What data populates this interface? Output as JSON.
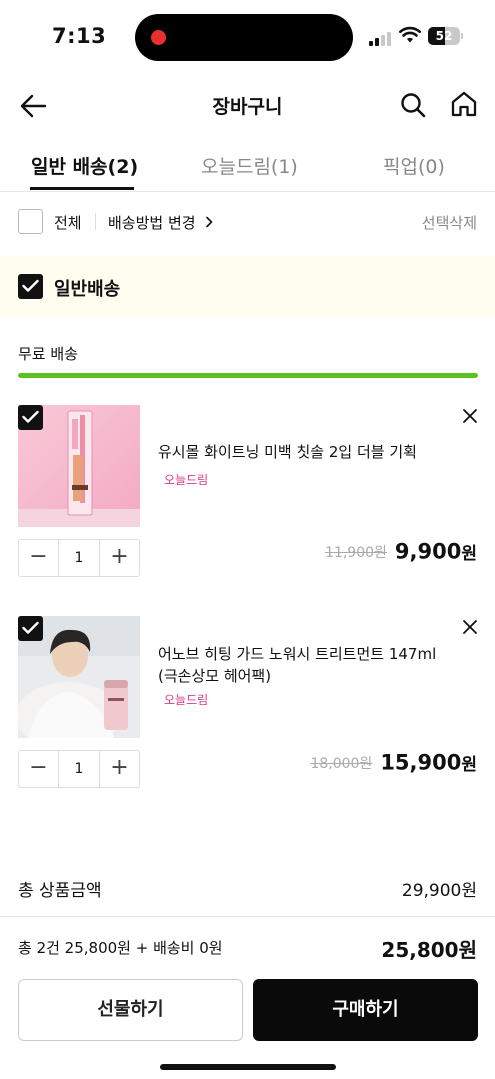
{
  "status_bar": {
    "time": "7:13",
    "battery": "52"
  },
  "header": {
    "title": "장바구니"
  },
  "tabs": [
    {
      "label": "일반 배송(2)",
      "active": true
    },
    {
      "label": "오늘드림(1)",
      "active": false
    },
    {
      "label": "픽업(0)",
      "active": false
    }
  ],
  "select_bar": {
    "all": "전체",
    "change_shipping": "배송방법 변경",
    "delete_selected": "선택삭제"
  },
  "group": {
    "title": "일반배송",
    "free_shipping": "무료 배송",
    "free_shipping_progress": 1.0
  },
  "items": [
    {
      "name": "유시몰 화이트닝 미백 칫솔 2입 더블 기획",
      "tag": "오늘드림",
      "qty": "1",
      "original_price": "11,900원",
      "sale_price": "9,900",
      "currency": "원"
    },
    {
      "name": "어노브 히팅 가드 노워시 트리트먼트 147ml (극손상모 헤어팩)",
      "tag": "오늘드림",
      "qty": "1",
      "original_price": "18,000원",
      "sale_price": "15,900",
      "currency": "원"
    }
  ],
  "totals": {
    "label": "총 상품금액",
    "value": "29,900원",
    "summary": "총 2건 25,800원 + 배송비 0원",
    "summary_total": "25,800원"
  },
  "buttons": {
    "gift": "선물하기",
    "buy": "구매하기"
  },
  "colors": {
    "accent_green": "#5cc21f",
    "tag_pink": "#d43a8a",
    "banner_bg": "#fffdf0"
  }
}
